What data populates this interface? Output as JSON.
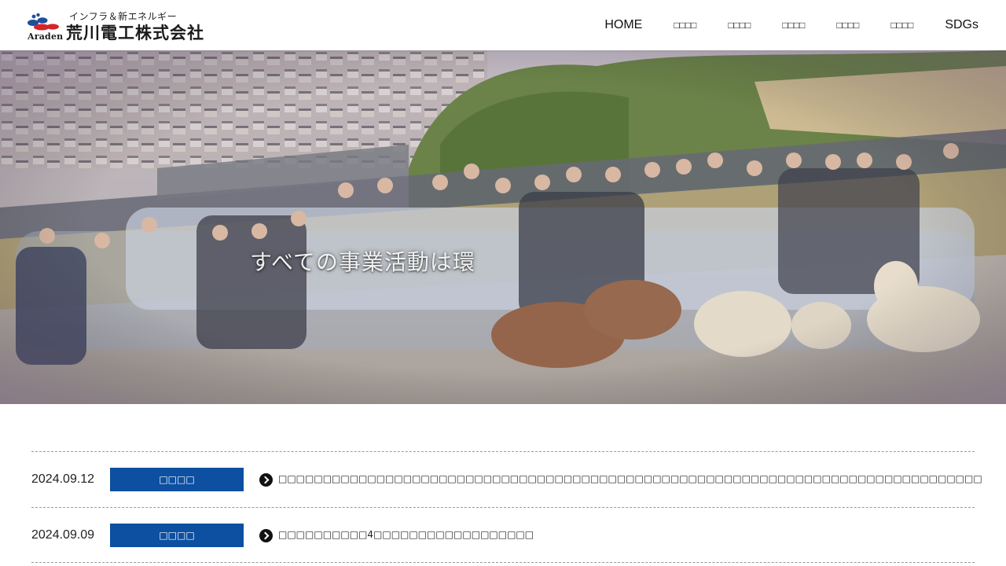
{
  "header": {
    "logo": {
      "tagline": "インフラ＆新エネルギー",
      "en": "Araden",
      "name": "荒川電工株式会社"
    },
    "nav": [
      {
        "label": "HOME"
      },
      {
        "label": "□□□□"
      },
      {
        "label": "□□□□"
      },
      {
        "label": "□□□□"
      },
      {
        "label": "□□□□"
      },
      {
        "label": "□□□□"
      },
      {
        "label": "SDGs"
      }
    ]
  },
  "hero": {
    "caption": "すべての事業活動は環"
  },
  "news": [
    {
      "date": "2024.09.12",
      "category": "□□□□",
      "title": "□□□□□□□□□□□□□□□□□□□□□□□□□□□□□□□□□□□□□□□□□□□□□□□□□□□□□□□□□□□□□□□□□□□□□□□□□□□□□□□"
    },
    {
      "date": "2024.09.09",
      "category": "□□□□",
      "title": "□□□□□□□□□□4□□□□□□□□□□□□□□□□□□"
    }
  ],
  "colors": {
    "accent": "#0d4fa0",
    "logo_blue": "#1d4f9c",
    "logo_red": "#d6232a"
  }
}
